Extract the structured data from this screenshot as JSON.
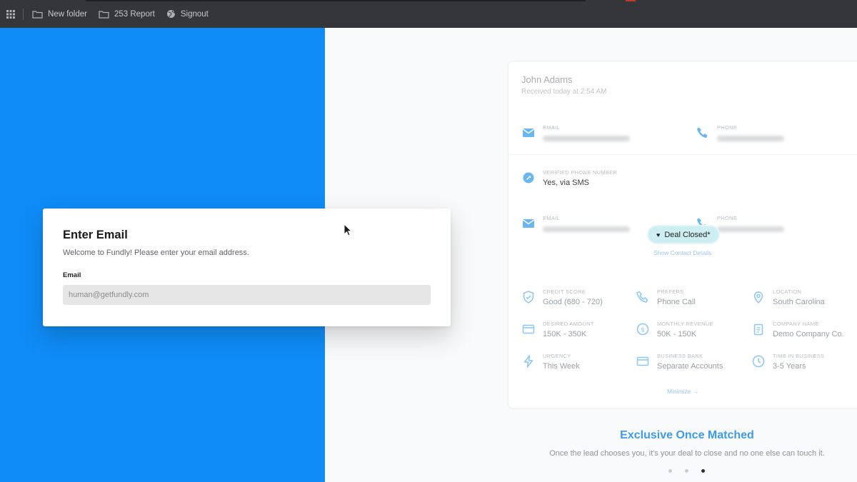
{
  "bookmarks": [
    {
      "label": "New folder",
      "icon": "folder-icon"
    },
    {
      "label": "253 Report",
      "icon": "folder-icon"
    },
    {
      "label": "Signout",
      "icon": "globe-icon"
    }
  ],
  "modal": {
    "title": "Enter Email",
    "subtitle": "Welcome to Fundly! Please enter your email address.",
    "email_label": "Email",
    "email_placeholder": "human@getfundly.com",
    "email_value": ""
  },
  "lead": {
    "name": "John Adams",
    "received": "Received today at 2:54 AM",
    "contact_row_1": {
      "email_label": "EMAIL",
      "phone_label": "PHONE"
    },
    "verified": {
      "label": "VERIFIED PHONE NUMBER",
      "value": "Yes, via SMS"
    },
    "contact_row_2": {
      "email_label": "EMAIL",
      "phone_label": "PHONE"
    },
    "badge": "Deal Closed*",
    "show_details": "Show Contact Details",
    "details": [
      {
        "label": "CREDIT SCORE",
        "value": "Good (680 - 720)",
        "icon": "shield-icon"
      },
      {
        "label": "PREFERS",
        "value": "Phone Call",
        "icon": "phone-icon"
      },
      {
        "label": "LOCATION",
        "value": "South Carolina",
        "icon": "location-pin-icon"
      },
      {
        "label": "DESIRED AMOUNT",
        "value": "150K - 350K",
        "icon": "card-icon"
      },
      {
        "label": "MONTHLY REVENUE",
        "value": "50K - 150K",
        "icon": "dollar-icon"
      },
      {
        "label": "COMPANY NAME",
        "value": "Demo Company Co.",
        "icon": "clipboard-icon"
      },
      {
        "label": "URGENCY",
        "value": "This Week",
        "icon": "lightning-icon"
      },
      {
        "label": "BUSINESS BANK",
        "value": "Separate Accounts",
        "icon": "card-icon"
      },
      {
        "label": "TIME IN BUSINESS",
        "value": "3-5 Years",
        "icon": "clock-icon"
      }
    ],
    "minimize": "Minimize →"
  },
  "promo": {
    "headline": "Exclusive Once Matched",
    "subline": "Once the lead chooses you, it's your deal to close and no one else can touch it."
  },
  "carousel": {
    "count": 3,
    "active_index": 2
  },
  "colors": {
    "blue_panel": "#0f8cf7",
    "headline_blue": "#3d9be9",
    "badge_bg": "#cdeef2",
    "icon_blue": "#6ab7f0"
  }
}
